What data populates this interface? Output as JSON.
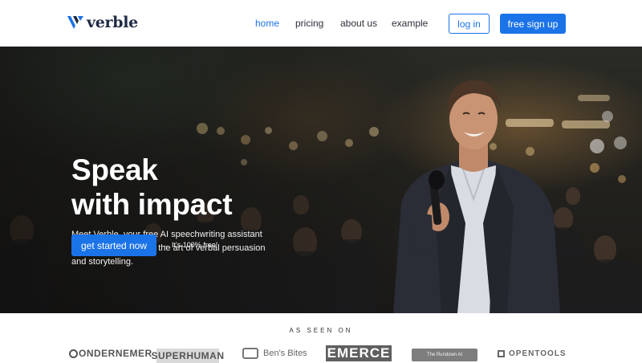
{
  "header": {
    "brand": "verble",
    "nav": [
      {
        "label": "home",
        "active": true
      },
      {
        "label": "pricing",
        "active": false
      },
      {
        "label": "about us",
        "active": false
      },
      {
        "label": "example",
        "active": false
      }
    ],
    "login_label": "log in",
    "signup_label": "free sign up"
  },
  "hero": {
    "title_line1": "Speak",
    "title_line2": "with impact",
    "description": "Meet Verble, your free AI speechwriting assistant that helps you master the art of verbal persuasion and storytelling.",
    "cta_label": "get started now",
    "cta_note": "It's 100% free!",
    "cta_note_arrow": "←"
  },
  "seen_on": {
    "label": "AS SEEN ON",
    "logos": [
      "ONDERNEMER",
      "SUPERHUMAN",
      "Ben's Bites",
      "EMERCE",
      "The Rundown AI",
      "OPENTOOLS"
    ]
  },
  "colors": {
    "accent": "#1b73e8",
    "brand_navy": "#1f2a44"
  }
}
